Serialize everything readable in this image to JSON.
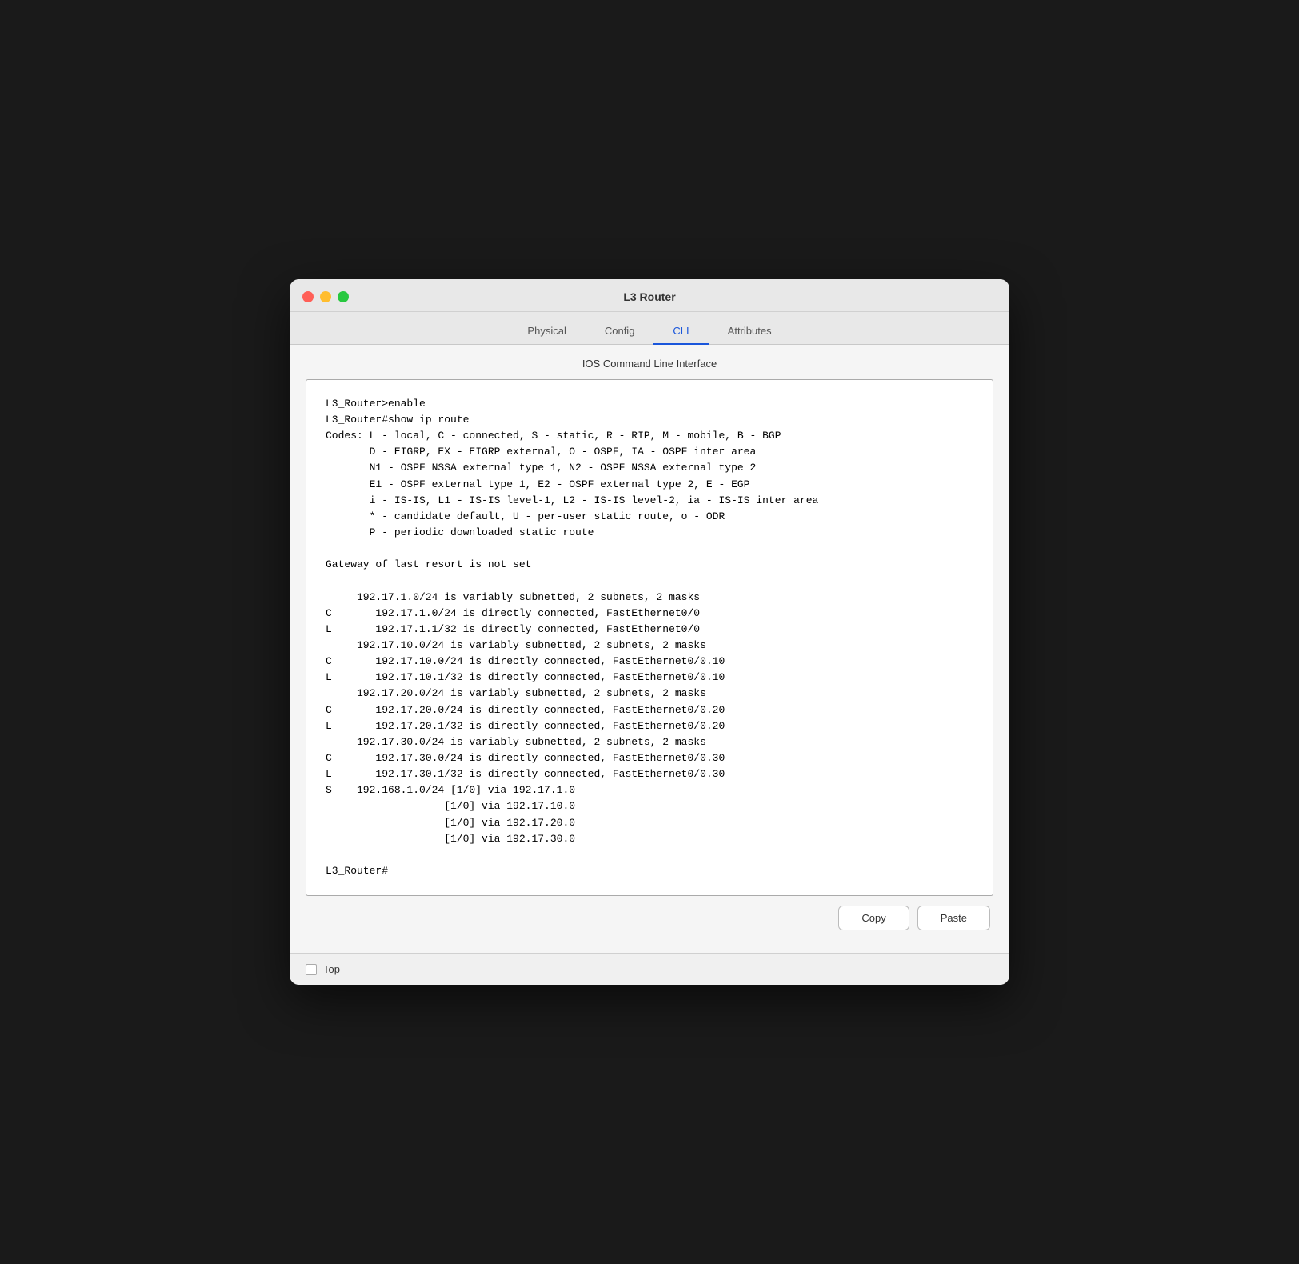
{
  "window": {
    "title": "L3 Router"
  },
  "tabs": [
    {
      "label": "Physical",
      "active": false
    },
    {
      "label": "Config",
      "active": false
    },
    {
      "label": "CLI",
      "active": true
    },
    {
      "label": "Attributes",
      "active": false
    }
  ],
  "section": {
    "label": "IOS Command Line Interface"
  },
  "terminal": {
    "content": "L3_Router>enable\nL3_Router#show ip route\nCodes: L - local, C - connected, S - static, R - RIP, M - mobile, B - BGP\n       D - EIGRP, EX - EIGRP external, O - OSPF, IA - OSPF inter area\n       N1 - OSPF NSSA external type 1, N2 - OSPF NSSA external type 2\n       E1 - OSPF external type 1, E2 - OSPF external type 2, E - EGP\n       i - IS-IS, L1 - IS-IS level-1, L2 - IS-IS level-2, ia - IS-IS inter area\n       * - candidate default, U - per-user static route, o - ODR\n       P - periodic downloaded static route\n\nGateway of last resort is not set\n\n     192.17.1.0/24 is variably subnetted, 2 subnets, 2 masks\nC       192.17.1.0/24 is directly connected, FastEthernet0/0\nL       192.17.1.1/32 is directly connected, FastEthernet0/0\n     192.17.10.0/24 is variably subnetted, 2 subnets, 2 masks\nC       192.17.10.0/24 is directly connected, FastEthernet0/0.10\nL       192.17.10.1/32 is directly connected, FastEthernet0/0.10\n     192.17.20.0/24 is variably subnetted, 2 subnets, 2 masks\nC       192.17.20.0/24 is directly connected, FastEthernet0/0.20\nL       192.17.20.1/32 is directly connected, FastEthernet0/0.20\n     192.17.30.0/24 is variably subnetted, 2 subnets, 2 masks\nC       192.17.30.0/24 is directly connected, FastEthernet0/0.30\nL       192.17.30.1/32 is directly connected, FastEthernet0/0.30\nS    192.168.1.0/24 [1/0] via 192.17.1.0\n                   [1/0] via 192.17.10.0\n                   [1/0] via 192.17.20.0\n                   [1/0] via 192.17.30.0\n\nL3_Router#"
  },
  "buttons": {
    "copy": "Copy",
    "paste": "Paste"
  },
  "footer": {
    "top_label": "Top",
    "top_checked": false
  }
}
